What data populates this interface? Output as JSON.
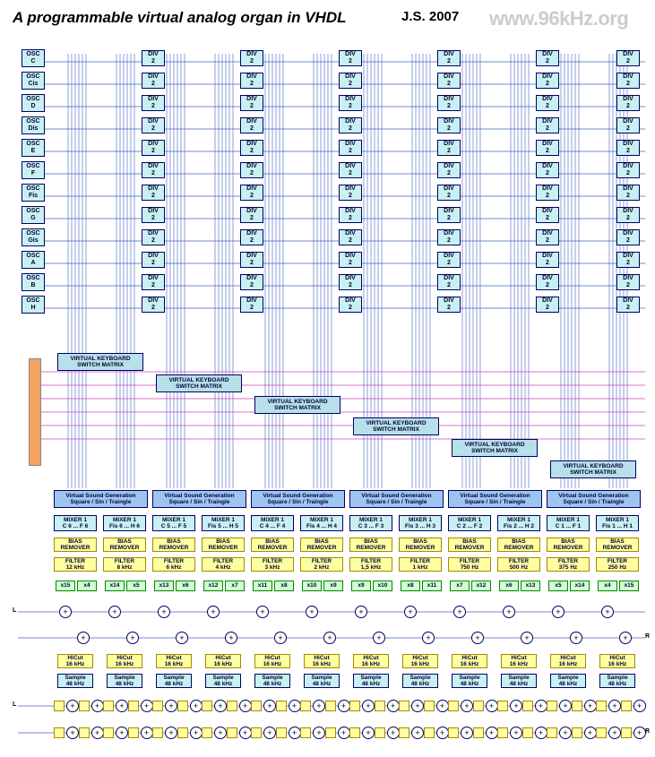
{
  "header": {
    "title": "A programmable virtual analog organ in VHDL",
    "author": "J.S. 2007",
    "watermark": "www.96kHz.org"
  },
  "oscillators": [
    "OSC\nC",
    "OSC\nCis",
    "OSC\nD",
    "OSC\nDis",
    "OSC\nE",
    "OSC\nF",
    "OSC\nFis",
    "OSC\nG",
    "OSC\nGis",
    "OSC\nA",
    "OSC\nB",
    "OSC\nH"
  ],
  "divLabel": "DIV\n2",
  "vkmLabel": "VIRTUAL KEYBOARD\nSWITCH MATRIX",
  "vsgLabel": "Virtual Sound Generation\nSquare / Sin / Traingle",
  "mixers": [
    [
      "MIXER 1\nC 6 ... F 6",
      "MIXER 1\nFis 6 ... H 6"
    ],
    [
      "MIXER 1\nC 5 ... F 5",
      "MIXER 1\nFis 5 ... H 5"
    ],
    [
      "MIXER 1\nC 4 ... F 4",
      "MIXER 1\nFis 4 ... H 4"
    ],
    [
      "MIXER 1\nC 3 ... F 3",
      "MIXER 1\nFis 3 ... H 3"
    ],
    [
      "MIXER 1\nC 2 ... F 2",
      "MIXER 1\nFis 2 ... H 2"
    ],
    [
      "MIXER 1\nC 1 ... F 1",
      "MIXER 1\nFis 1 ... H 1"
    ]
  ],
  "biasLabel": "BIAS\nREMOVER",
  "filters": [
    "FILTER\n12 kHz",
    "FILTER\n8 kHz",
    "FILTER\n6 kHz",
    "FILTER\n4 kHz",
    "FILTER\n3 kHz",
    "FILTER\n2 kHz",
    "FILTER\n1,5 kHz",
    "FILTER\n1 kHz",
    "FILTER\n750 Hz",
    "FILTER\n500 Hz",
    "FILTER\n375 Hz",
    "FILTER\n250 Hz"
  ],
  "mults": [
    [
      "x15",
      "x4"
    ],
    [
      "x14",
      "x5"
    ],
    [
      "x13",
      "x6"
    ],
    [
      "x12",
      "x7"
    ],
    [
      "x11",
      "x8"
    ],
    [
      "x10",
      "x9"
    ],
    [
      "x9",
      "x10"
    ],
    [
      "x8",
      "x11"
    ],
    [
      "x7",
      "x12"
    ],
    [
      "x6",
      "x13"
    ],
    [
      "x5",
      "x14"
    ],
    [
      "x4",
      "x15"
    ]
  ],
  "hicutLabel": "HiCut\n16 kHz",
  "sampleLabel": "Sample\n48 kHz",
  "left": "L",
  "right": "R"
}
